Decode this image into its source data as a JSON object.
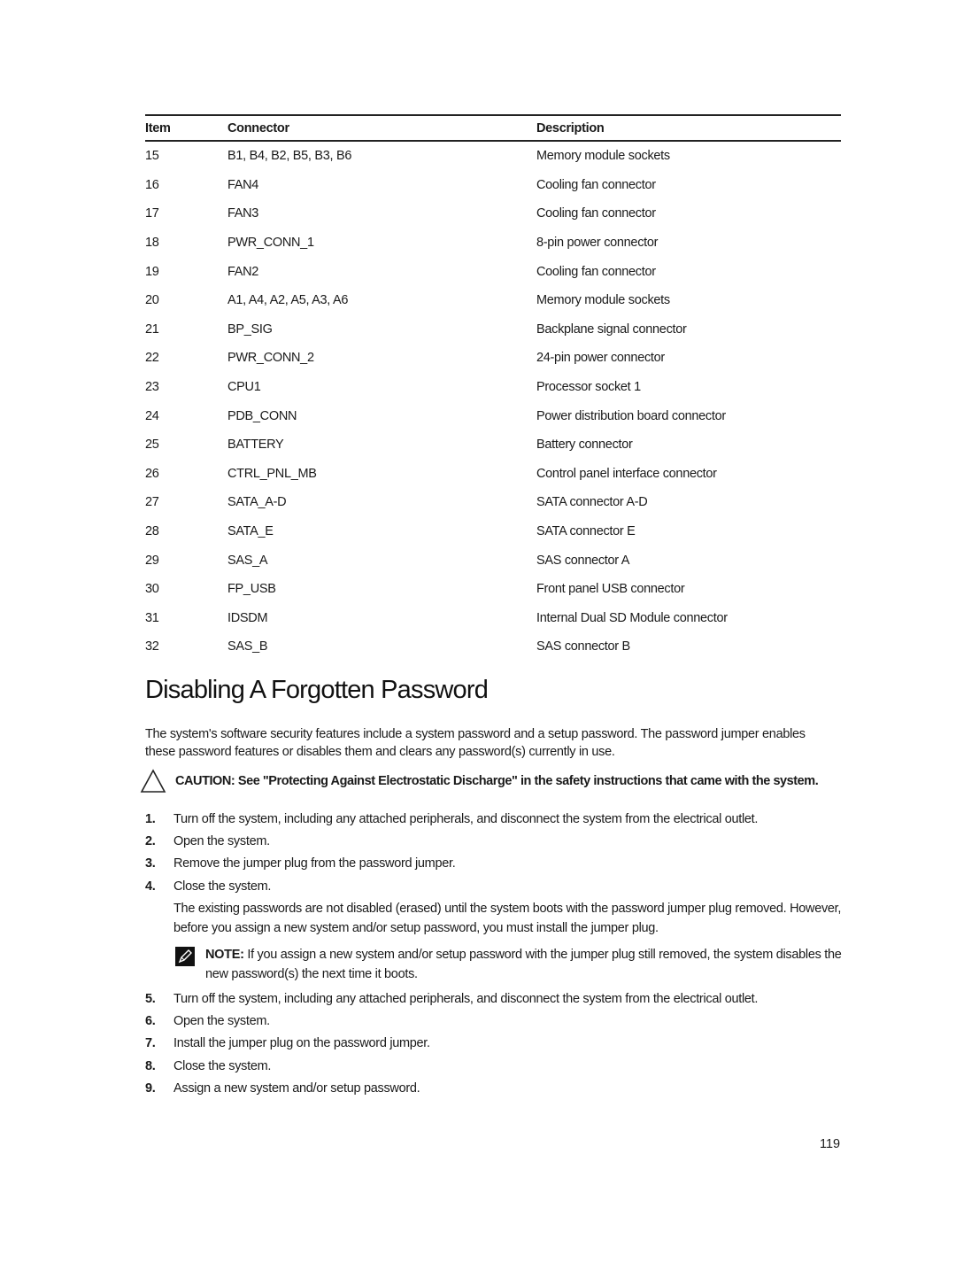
{
  "table": {
    "headers": {
      "item": "Item",
      "connector": "Connector",
      "description": "Description"
    },
    "rows": [
      {
        "item": "15",
        "connector": "B1, B4, B2, B5, B3, B6",
        "description": "Memory module sockets"
      },
      {
        "item": "16",
        "connector": "FAN4",
        "description": "Cooling fan connector"
      },
      {
        "item": "17",
        "connector": "FAN3",
        "description": "Cooling fan connector"
      },
      {
        "item": "18",
        "connector": "PWR_CONN_1",
        "description": "8-pin power connector"
      },
      {
        "item": "19",
        "connector": "FAN2",
        "description": "Cooling fan connector"
      },
      {
        "item": "20",
        "connector": "A1, A4, A2, A5, A3, A6",
        "description": "Memory module sockets"
      },
      {
        "item": "21",
        "connector": "BP_SIG",
        "description": "Backplane signal connector"
      },
      {
        "item": "22",
        "connector": "PWR_CONN_2",
        "description": "24-pin power connector"
      },
      {
        "item": "23",
        "connector": "CPU1",
        "description": "Processor socket 1"
      },
      {
        "item": "24",
        "connector": "PDB_CONN",
        "description": "Power distribution board connector"
      },
      {
        "item": "25",
        "connector": "BATTERY",
        "description": "Battery connector"
      },
      {
        "item": "26",
        "connector": "CTRL_PNL_MB",
        "description": "Control panel interface connector"
      },
      {
        "item": "27",
        "connector": "SATA_A-D",
        "description": "SATA connector A-D"
      },
      {
        "item": "28",
        "connector": "SATA_E",
        "description": "SATA connector E"
      },
      {
        "item": "29",
        "connector": "SAS_A",
        "description": "SAS connector A"
      },
      {
        "item": "30",
        "connector": "FP_USB",
        "description": "Front panel USB connector"
      },
      {
        "item": "31",
        "connector": "IDSDM",
        "description": "Internal Dual SD Module connector"
      },
      {
        "item": "32",
        "connector": "SAS_B",
        "description": "SAS connector B"
      }
    ]
  },
  "section": {
    "title": "Disabling A Forgotten Password",
    "intro": "The system's software security features include a system password and a setup password. The password jumper enables these password features or disables them and clears any password(s) currently in use.",
    "caution": {
      "icon": "caution-triangle-icon",
      "text": "CAUTION: See \"Protecting Against Electrostatic Discharge\" in the safety instructions that came with the system."
    },
    "steps": [
      {
        "num": "1.",
        "text": "Turn off the system, including any attached peripherals, and disconnect the system from the electrical outlet."
      },
      {
        "num": "2.",
        "text": "Open the system."
      },
      {
        "num": "3.",
        "text": "Remove the jumper plug from the password jumper."
      },
      {
        "num": "4.",
        "text": "Close the system.",
        "extra": "The existing passwords are not disabled (erased) until the system boots with the password jumper plug removed. However, before you assign a new system and/or setup password, you must install the jumper plug."
      },
      {
        "num": "5.",
        "text": "Turn off the system, including any attached peripherals, and disconnect the system from the electrical outlet."
      },
      {
        "num": "6.",
        "text": "Open the system."
      },
      {
        "num": "7.",
        "text": "Install the jumper plug on the password jumper."
      },
      {
        "num": "8.",
        "text": "Close the system."
      },
      {
        "num": "9.",
        "text": "Assign a new system and/or setup password."
      }
    ],
    "note": {
      "icon": "note-pencil-icon",
      "label": "NOTE:",
      "text": " If you assign a new system and/or setup password with the jumper plug still removed, the system disables the new password(s) the next time it boots."
    }
  },
  "footer": {
    "page_number": "119"
  }
}
